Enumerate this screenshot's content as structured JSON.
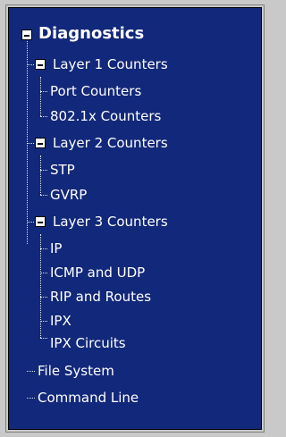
{
  "tree": {
    "root": "Diagnostics",
    "layer1": {
      "label": "Layer 1 Counters",
      "children": [
        "Port Counters",
        "802.1x Counters"
      ]
    },
    "layer2": {
      "label": "Layer 2 Counters",
      "children": [
        "STP",
        "GVRP"
      ]
    },
    "layer3": {
      "label": "Layer 3 Counters",
      "children": [
        "IP",
        "ICMP and UDP",
        "RIP and Routes",
        "IPX",
        "IPX Circuits"
      ]
    },
    "leaves": [
      "File System",
      "Command Line"
    ]
  }
}
